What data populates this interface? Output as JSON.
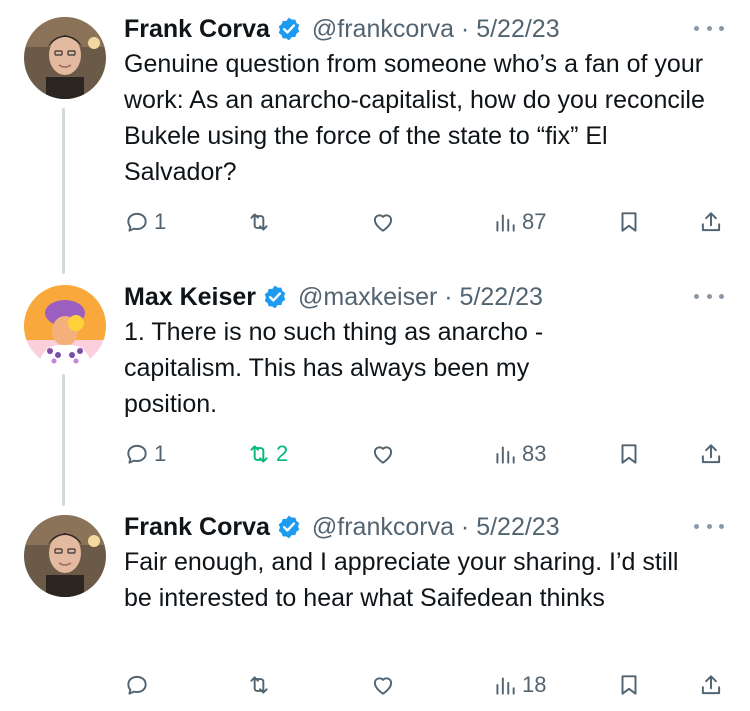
{
  "tweets": [
    {
      "name": "Frank Corva",
      "handle": "@frankcorva",
      "date": "5/22/23",
      "text": "Genuine question from someone who’s a fan of your work: As an anarcho-capitalist, how do you reconcile Bukele using the force of the state to “fix” El Salvador?",
      "replies": "1",
      "retweets": "",
      "views": "87"
    },
    {
      "name": "Max Keiser",
      "handle": "@maxkeiser",
      "date": "5/22/23",
      "text": "1. There is no such thing as anarcho -capitalism. This has always been my position.",
      "replies": "1",
      "retweets": "2",
      "views": "83"
    },
    {
      "name": "Frank Corva",
      "handle": "@frankcorva",
      "date": "5/22/23",
      "text": "Fair enough, and I appreciate your sharing. I’d still be interested to hear what Saifedean thinks",
      "replies": "",
      "retweets": "",
      "views": "18"
    }
  ],
  "colors": {
    "verified": "#1d9bf0",
    "retweet_active": "#00ba7c",
    "secondary_text": "#536471",
    "thread_line": "#cfd9de"
  },
  "icons": [
    "reply-icon",
    "retweet-icon",
    "like-icon",
    "views-icon",
    "bookmark-icon",
    "share-icon",
    "verified-badge-icon",
    "more-options-icon"
  ]
}
